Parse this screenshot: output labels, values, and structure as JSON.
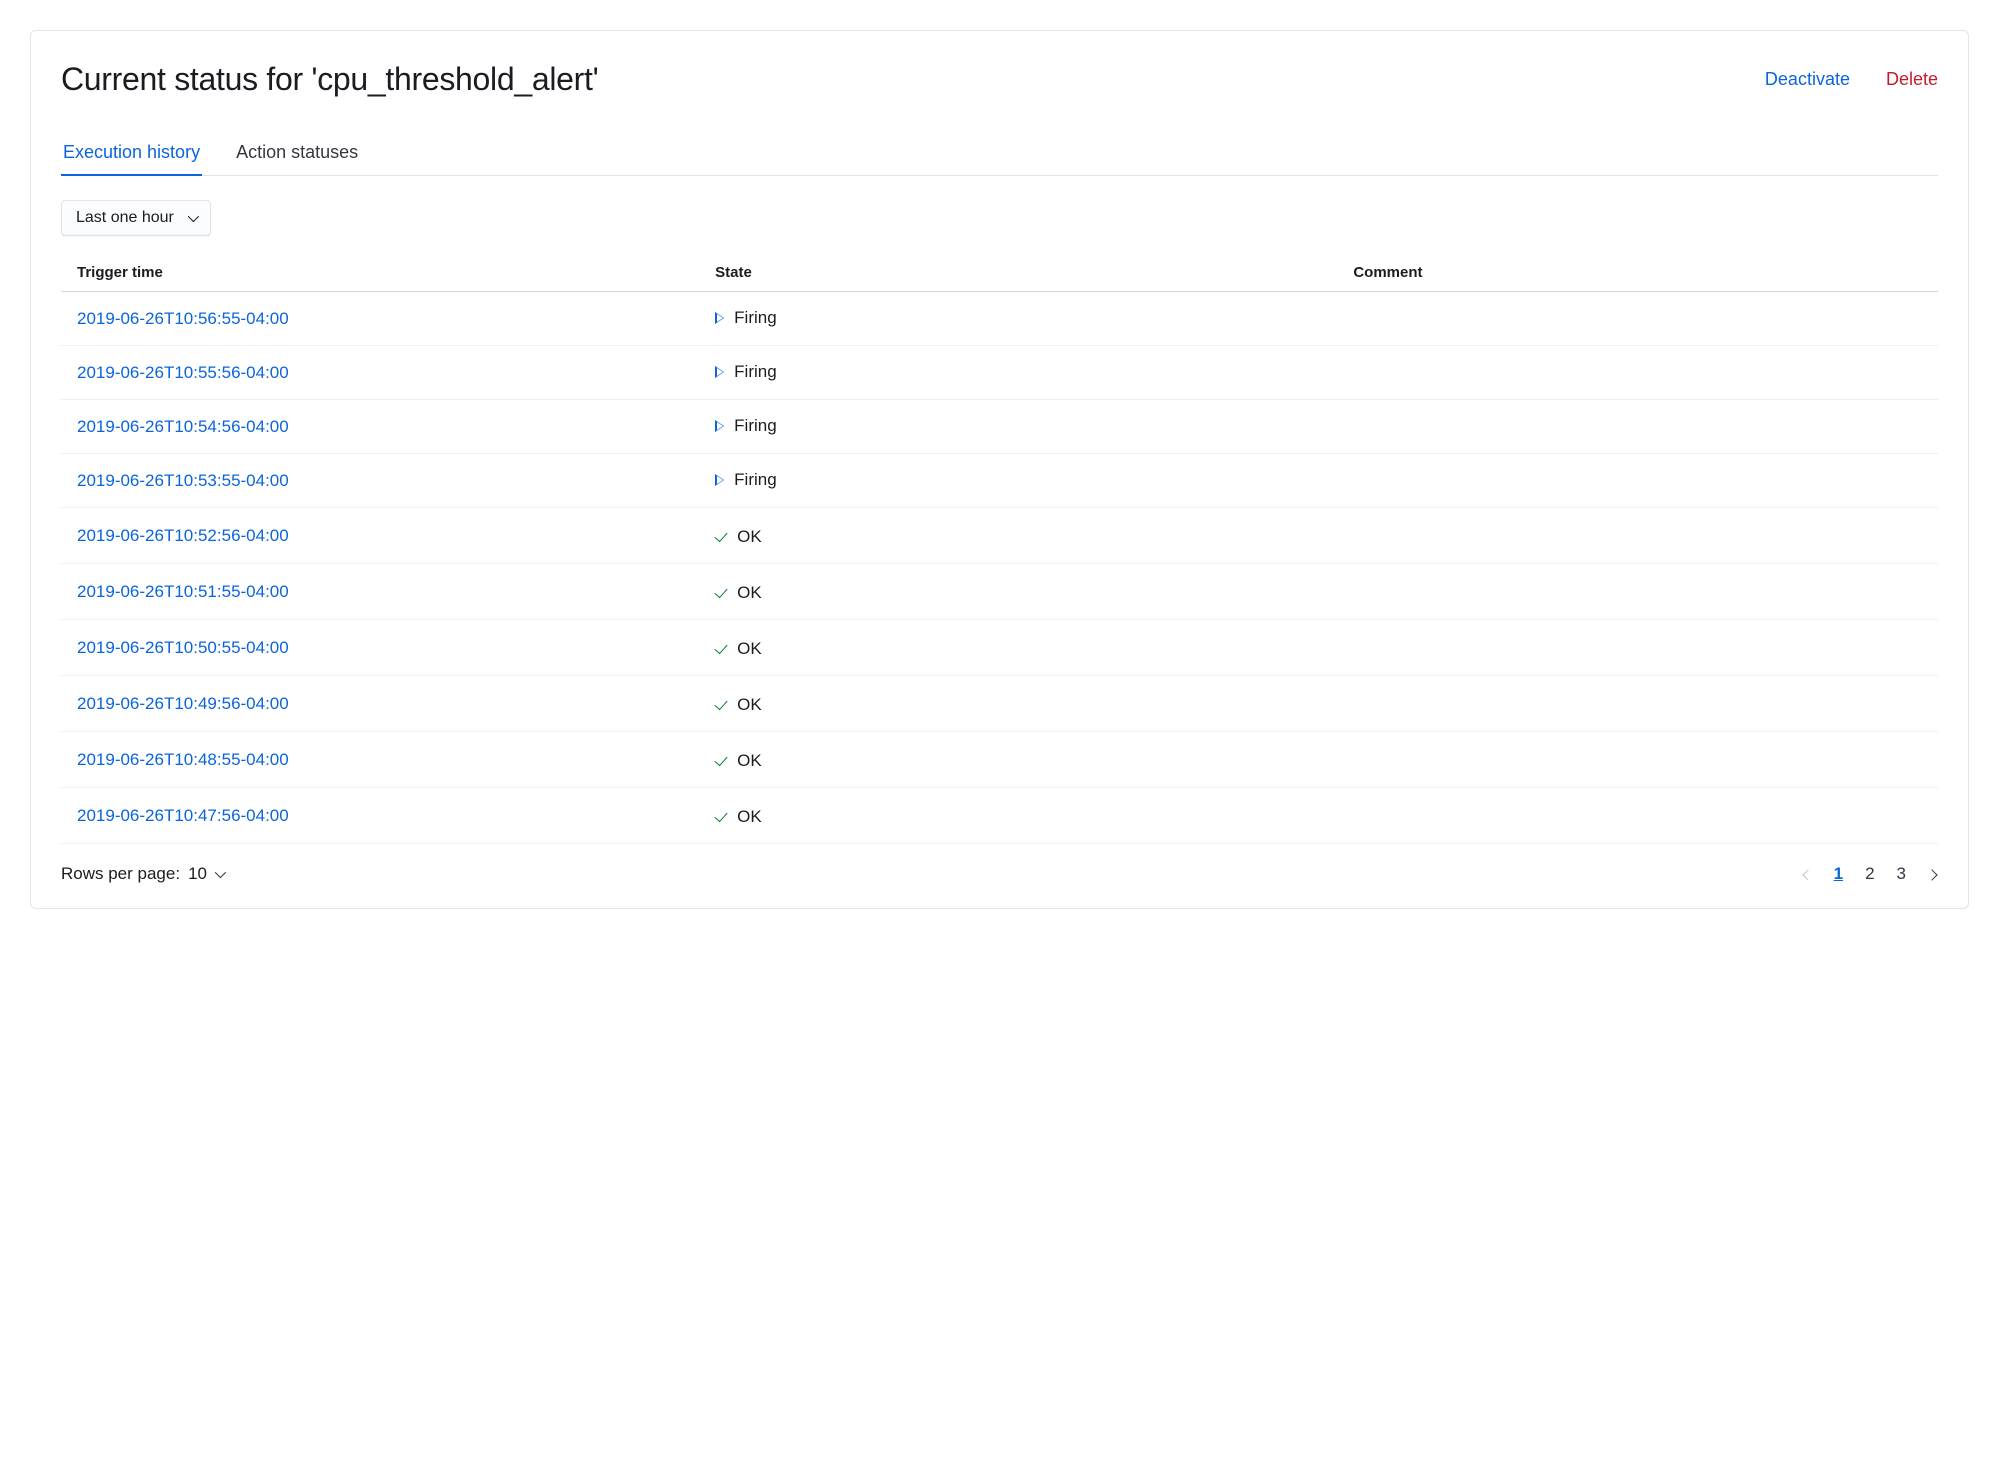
{
  "header": {
    "title": "Current status for 'cpu_threshold_alert'",
    "deactivate_label": "Deactivate",
    "delete_label": "Delete"
  },
  "tabs": [
    {
      "label": "Execution history",
      "active": true
    },
    {
      "label": "Action statuses",
      "active": false
    }
  ],
  "filter": {
    "time_range": "Last one hour"
  },
  "table": {
    "columns": {
      "trigger_time": "Trigger time",
      "state": "State",
      "comment": "Comment"
    },
    "rows": [
      {
        "trigger_time": "2019-06-26T10:56:55-04:00",
        "state": "Firing",
        "state_icon": "play",
        "comment": ""
      },
      {
        "trigger_time": "2019-06-26T10:55:56-04:00",
        "state": "Firing",
        "state_icon": "play",
        "comment": ""
      },
      {
        "trigger_time": "2019-06-26T10:54:56-04:00",
        "state": "Firing",
        "state_icon": "play",
        "comment": ""
      },
      {
        "trigger_time": "2019-06-26T10:53:55-04:00",
        "state": "Firing",
        "state_icon": "play",
        "comment": ""
      },
      {
        "trigger_time": "2019-06-26T10:52:56-04:00",
        "state": "OK",
        "state_icon": "check",
        "comment": ""
      },
      {
        "trigger_time": "2019-06-26T10:51:55-04:00",
        "state": "OK",
        "state_icon": "check",
        "comment": ""
      },
      {
        "trigger_time": "2019-06-26T10:50:55-04:00",
        "state": "OK",
        "state_icon": "check",
        "comment": ""
      },
      {
        "trigger_time": "2019-06-26T10:49:56-04:00",
        "state": "OK",
        "state_icon": "check",
        "comment": ""
      },
      {
        "trigger_time": "2019-06-26T10:48:55-04:00",
        "state": "OK",
        "state_icon": "check",
        "comment": ""
      },
      {
        "trigger_time": "2019-06-26T10:47:56-04:00",
        "state": "OK",
        "state_icon": "check",
        "comment": ""
      }
    ]
  },
  "pagination": {
    "rows_per_page_label": "Rows per page: ",
    "rows_per_page_value": "10",
    "pages": [
      "1",
      "2",
      "3"
    ],
    "current_page": "1"
  }
}
